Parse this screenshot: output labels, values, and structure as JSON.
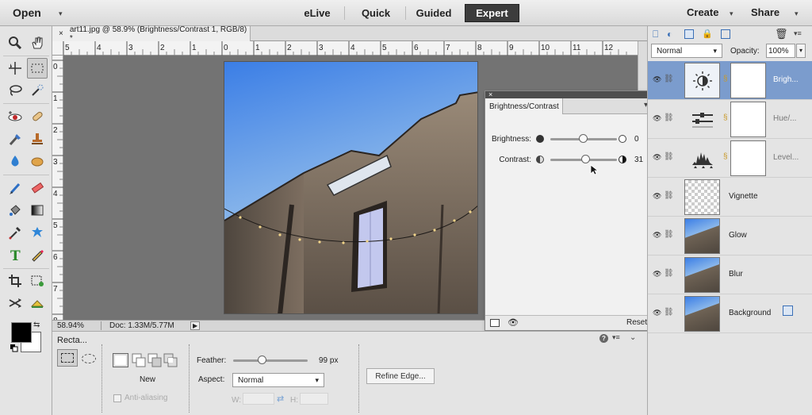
{
  "topbar": {
    "open_label": "Open",
    "modes": [
      "eLive",
      "Quick",
      "Guided",
      "Expert"
    ],
    "create_label": "Create",
    "share_label": "Share"
  },
  "document": {
    "tab_title": "art11.jpg @ 58.9% (Brightness/Contrast 1, RGB/8) *",
    "zoom": "58.94%",
    "doc_size": "Doc: 1.33M/5.77M",
    "hruler_labels": [
      "5",
      "4",
      "3",
      "2",
      "1",
      "0",
      "1",
      "2",
      "3",
      "4",
      "5",
      "6",
      "7",
      "8",
      "9",
      "10",
      "11",
      "12"
    ],
    "vruler_labels": [
      "0",
      "1",
      "2",
      "3",
      "4",
      "5",
      "6",
      "7",
      "8"
    ]
  },
  "bc_panel": {
    "close_glyph": "×",
    "tab_label": "Brightness/Contrast",
    "brightness_label": "Brightness:",
    "brightness_value": "0",
    "contrast_label": "Contrast:",
    "contrast_value": "31",
    "reset_label": "Reset"
  },
  "options": {
    "tool_name": "Recta...",
    "new_label": "New",
    "antialias_label": "Anti-aliasing",
    "feather_label": "Feather:",
    "feather_value": "99 px",
    "aspect_label": "Aspect:",
    "aspect_value": "Normal",
    "w_label": "W:",
    "h_label": "H:",
    "refine_label": "Refine Edge..."
  },
  "layers_panel": {
    "blend_mode": "Normal",
    "opacity_label": "Opacity:",
    "opacity_value": "100%",
    "layers": [
      {
        "name": "Brigh..."
      },
      {
        "name": "Hue/..."
      },
      {
        "name": "Level..."
      },
      {
        "name": "Vignette"
      },
      {
        "name": "Glow"
      },
      {
        "name": "Blur"
      },
      {
        "name": "Background"
      }
    ]
  },
  "colors": {
    "accent_selected_layer": "#7b9ccd",
    "foreground_swatch": "#000000",
    "background_swatch": "#ffffff"
  }
}
